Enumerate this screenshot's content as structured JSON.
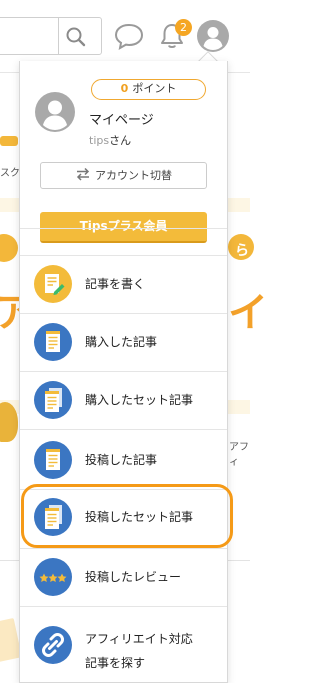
{
  "header": {
    "notification_count": "2",
    "icons": [
      "search-icon",
      "chat-bubble-icon",
      "bell-icon",
      "user-avatar-icon"
    ]
  },
  "background": {
    "fragment_sukuri": "スク",
    "fragment_ra": "ら",
    "fragment_a": "ア",
    "fragment_i": "イ",
    "fragment_afi": "アフィ"
  },
  "profile": {
    "points_value": "0",
    "points_label": "ポイント",
    "mypage_label": "マイページ",
    "username": "tips",
    "username_suffix": "さん"
  },
  "account_switch_label": "アカウント切替",
  "tips_plus_label": "Tipsプラス会員",
  "menu": {
    "items": [
      {
        "label": "記事を書く",
        "icon": "write-article-icon"
      },
      {
        "label": "購入した記事",
        "icon": "document-icon"
      },
      {
        "label": "購入したセット記事",
        "icon": "document-set-icon"
      },
      {
        "label": "投稿した記事",
        "icon": "document-icon"
      },
      {
        "label": "投稿したセット記事",
        "icon": "document-set-icon"
      },
      {
        "label": "投稿したレビュー",
        "icon": "stars-icon"
      },
      {
        "label": "アフィリエイト対応",
        "label2": "記事を探す",
        "icon": "link-icon"
      }
    ]
  },
  "colors": {
    "accent_orange": "#f3bb3a",
    "highlight_orange": "#f59a17",
    "icon_blue": "#3b76c2"
  }
}
